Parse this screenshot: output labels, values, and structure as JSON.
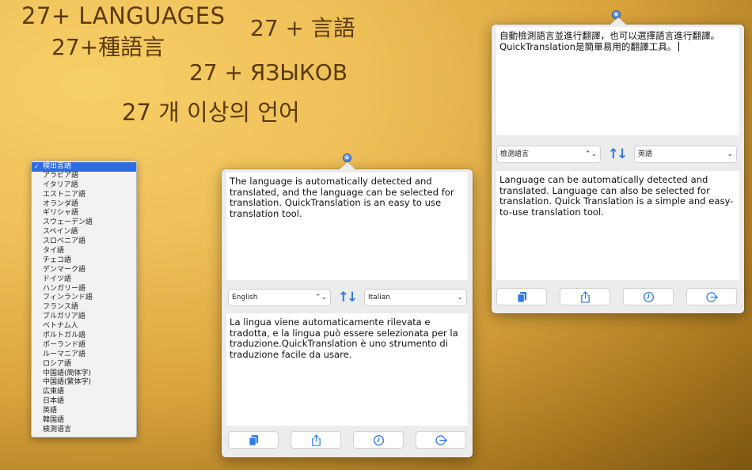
{
  "headlines": {
    "h1": "27+ LANGUAGES",
    "h2": "27+種語言",
    "h3": "27 + 言語",
    "h4": "27 + ЯЗЫКОВ",
    "h5": "27 개 이상의 언어"
  },
  "language_menu": {
    "items": [
      "検出言語",
      "アラビア語",
      "イタリア語",
      "エストニア語",
      "オランダ語",
      "ギリシャ語",
      "スウェーデン語",
      "スペイン語",
      "スロベニア語",
      "タイ語",
      "チェコ語",
      "デンマーク語",
      "ドイツ語",
      "ハンガリー語",
      "フィンランド語",
      "フランス語",
      "ブルガリア語",
      "ベトナム人",
      "ポルトガル語",
      "ポーランド語",
      "ルーマニア語",
      "ロシア語",
      "中国語(簡体字)",
      "中国語(繁体字)",
      "広東語",
      "日本語",
      "英語",
      "韓国語",
      "検測语言"
    ],
    "check_mark": "✓"
  },
  "popover_left": {
    "source_text": "The language is automatically detected and translated, and the language can be selected for translation. QuickTranslation is an easy to use translation tool.",
    "from_language": "English",
    "to_language": "Italian",
    "translated_text": "La lingua viene automaticamente rilevata e tradotta, e la lingua può essere selezionata per la traduzione.QuickTranslation è uno strumento di traduzione facile da usare.",
    "from_arrow": "⌃⌄",
    "to_arrow": "⌄",
    "swap_glyph": "↑↓"
  },
  "popover_right": {
    "source_text": "自動檢測語言並進行翻譯，也可以選擇語言進行翻譯。QuickTranslation是簡單易用的翻譯工具。",
    "from_language": "檢測語言",
    "to_language": "英語",
    "translated_text": "Language can be automatically detected and translated. Language can also be selected for translation. Quick Translation is a simple and easy-to-use translation tool.",
    "from_arrow": "⌃⌄",
    "to_arrow": "⌄",
    "swap_glyph": "↑↓"
  },
  "toolbar_icons": [
    "copy-icon",
    "share-icon",
    "history-icon",
    "exit-icon"
  ],
  "colors": {
    "accent": "#2f7ae5",
    "selection": "#2d6de3",
    "headline": "#5a3a0a"
  }
}
